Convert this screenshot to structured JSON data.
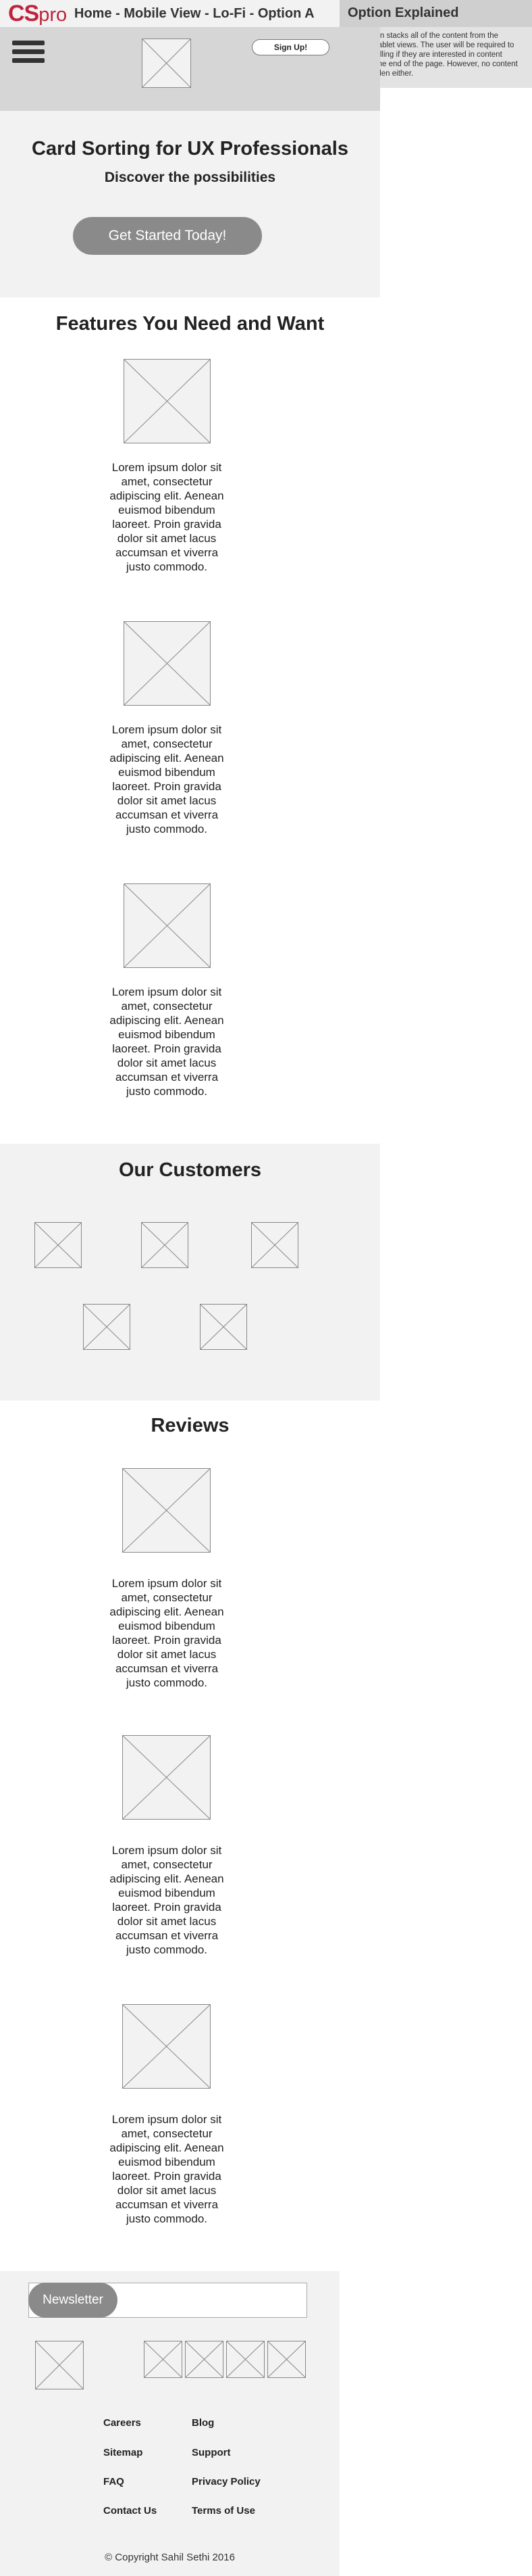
{
  "title_bar": {
    "logo_cs": "CS",
    "logo_pro": "pro",
    "title": "Home - Mobile View - Lo-Fi - Option A"
  },
  "side_panel": {
    "title": "Option Explained",
    "body": "This option stacks all of the content from the desktop/tablet views. The user will be required to keep scrolling if they are interested in content towards the end of the page. However, no content is left hidden either."
  },
  "header": {
    "signup_label": "Sign Up!",
    "menu_icon": "hamburger-menu-icon"
  },
  "hero": {
    "title": "Card Sorting for UX Professionals",
    "subtitle": "Discover the possibilities",
    "cta_label": "Get Started Today!"
  },
  "features": {
    "title": "Features You Need and Want",
    "items": [
      {
        "text": "Lorem ipsum dolor sit amet, consectetur adipiscing elit. Aenean euismod bibendum laoreet. Proin gravida dolor sit amet lacus accumsan et viverra justo commodo."
      },
      {
        "text": "Lorem ipsum dolor sit amet, consectetur adipiscing elit. Aenean euismod bibendum laoreet. Proin gravida dolor sit amet lacus accumsan et viverra justo commodo."
      },
      {
        "text": "Lorem ipsum dolor sit amet, consectetur adipiscing elit. Aenean euismod bibendum laoreet. Proin gravida dolor sit amet lacus accumsan et viverra justo commodo."
      }
    ]
  },
  "customers": {
    "title": "Our Customers"
  },
  "reviews": {
    "title": "Reviews",
    "items": [
      {
        "text": "Lorem ipsum dolor sit amet, consectetur adipiscing elit. Aenean euismod bibendum laoreet. Proin gravida dolor sit amet lacus accumsan et viverra justo commodo."
      },
      {
        "text": "Lorem ipsum dolor sit amet, consectetur adipiscing elit. Aenean euismod bibendum laoreet. Proin gravida dolor sit amet lacus accumsan et viverra justo commodo."
      },
      {
        "text": "Lorem ipsum dolor sit amet, consectetur adipiscing elit. Aenean euismod bibendum laoreet. Proin gravida dolor sit amet lacus accumsan et viverra justo commodo."
      }
    ]
  },
  "footer": {
    "newsletter_label": "Newsletter",
    "links": {
      "careers": "Careers",
      "blog": "Blog",
      "sitemap": "Sitemap",
      "support": "Support",
      "faq": "FAQ",
      "privacy": "Privacy Policy",
      "contact": "Contact Us",
      "terms": "Terms of Use"
    },
    "copyright": "© Copyright Sahil Sethi 2016"
  },
  "colors": {
    "brand": "#c0233c",
    "button_gray": "#8a8a8a",
    "header_gray": "#d6d6d6",
    "section_gray": "#f2f2f2"
  }
}
